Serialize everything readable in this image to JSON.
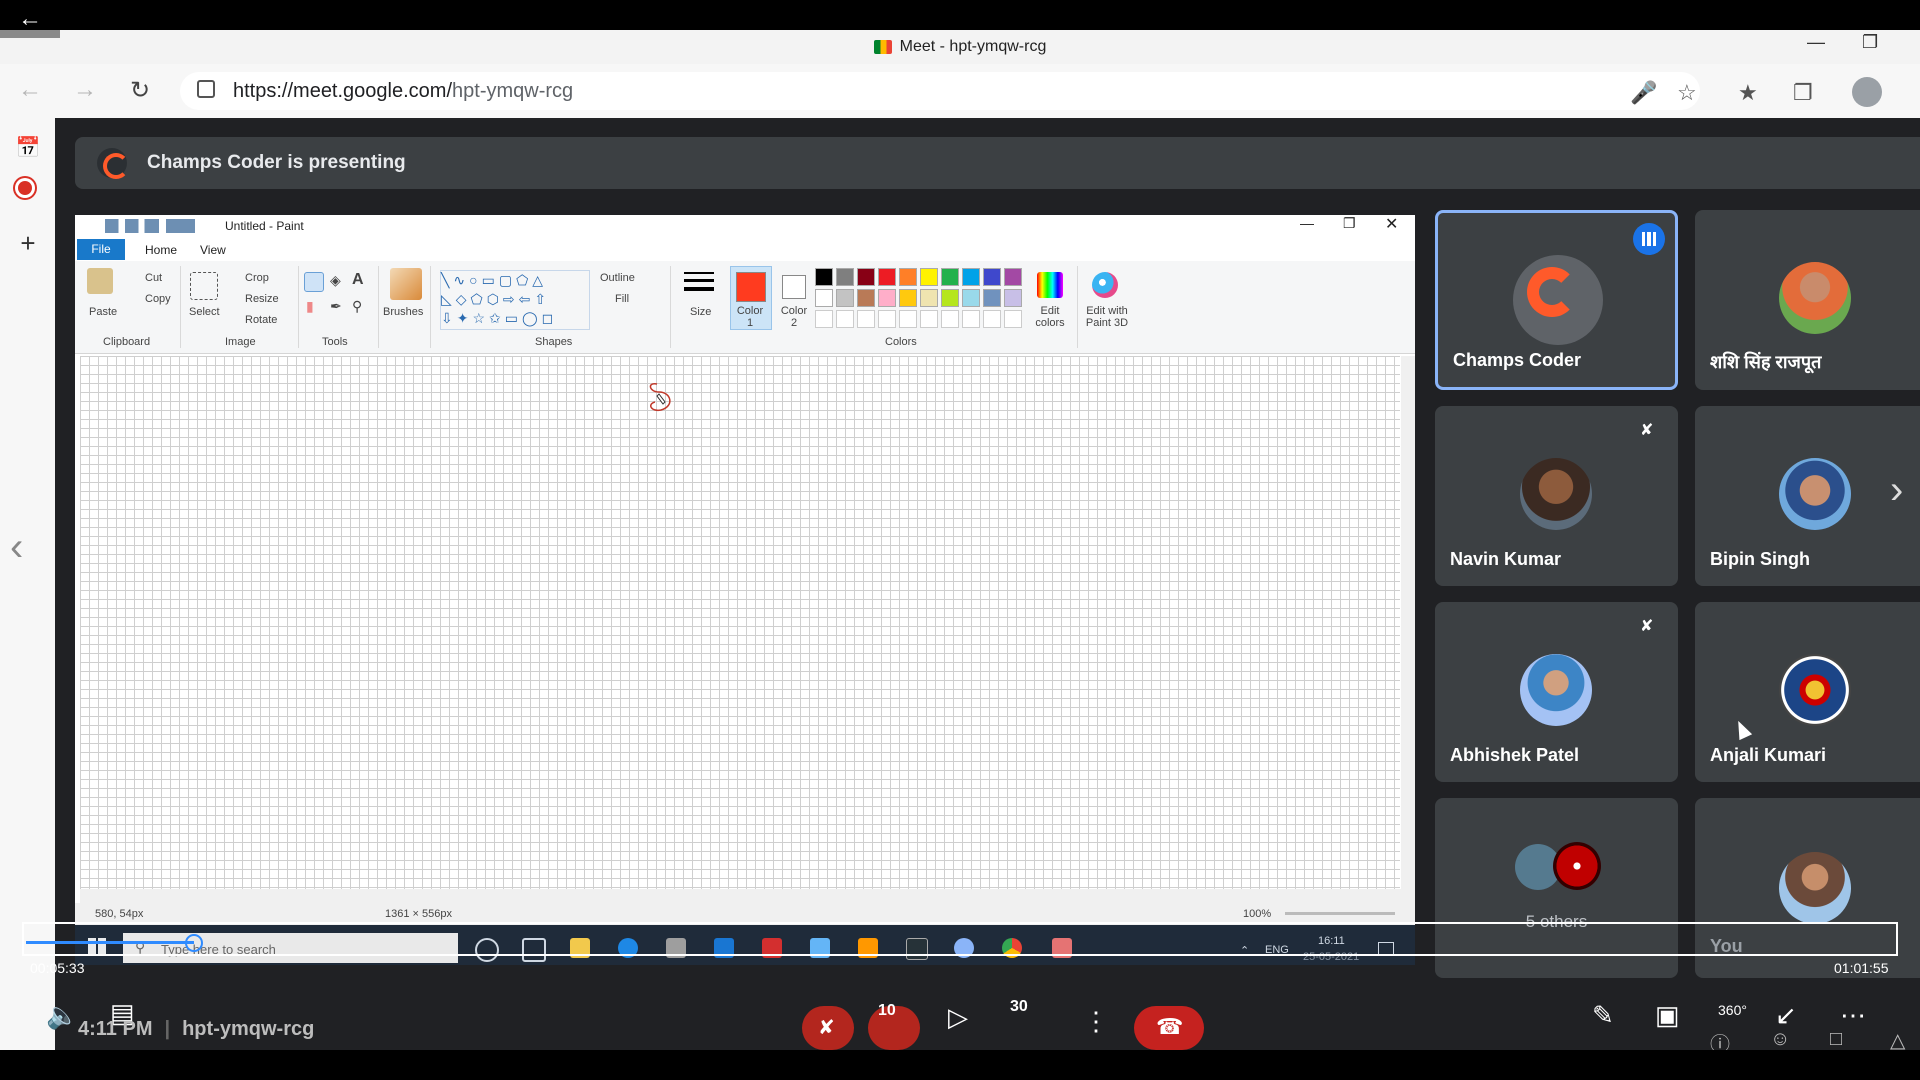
{
  "browser": {
    "tab_title": "Meet - hpt-ymqw-rcg",
    "url_host": "https://meet.google.com/",
    "url_path": "hpt-ymqw-rcg"
  },
  "meet": {
    "presenting_text": "Champs Coder is presenting",
    "meeting_code": "hpt-ymqw-rcg",
    "clock": "4:11 PM"
  },
  "paint": {
    "title": "Untitled - Paint",
    "tabs": [
      "File",
      "Home",
      "View"
    ],
    "clipboard": {
      "paste": "Paste",
      "cut": "Cut",
      "copy": "Copy",
      "label": "Clipboard"
    },
    "image": {
      "select": "Select",
      "crop": "Crop",
      "resize": "Resize",
      "rotate": "Rotate",
      "label": "Image"
    },
    "tools_label": "Tools",
    "brushes": "Brushes",
    "shapes": {
      "outline": "Outline",
      "fill": "Fill",
      "label": "Shapes"
    },
    "size": "Size",
    "color1": "Color 1",
    "color2": "Color 2",
    "colors_label": "Colors",
    "edit_colors": "Edit colors",
    "edit_3d": "Edit with Paint 3D",
    "status_pos": "580, 54px",
    "status_size": "1361 × 556px",
    "zoom": "100%",
    "palette": [
      "#000000",
      "#7f7f7f",
      "#880015",
      "#ed1c24",
      "#ff7f27",
      "#fff200",
      "#22b14c",
      "#00a2e8",
      "#3f48cc",
      "#a349a4",
      "#ffffff",
      "#c3c3c3",
      "#b97a57",
      "#ffaec9",
      "#ffc90e",
      "#efe4b0",
      "#b5e61d",
      "#99d9ea",
      "#7092be",
      "#c8bfe7"
    ],
    "color1_hex": "#ff3b1f"
  },
  "shared_taskbar": {
    "search_placeholder": "Type here to search",
    "lang": "ENG",
    "time": "16:11",
    "date": "25-05-2021"
  },
  "participants": [
    {
      "name": "Champs Coder",
      "speaking": true
    },
    {
      "name": "शशि सिंह राजपूत",
      "muted": true
    },
    {
      "name": "Navin Kumar",
      "muted": true
    },
    {
      "name": "Bipin Singh",
      "muted": true
    },
    {
      "name": "Abhishek Patel",
      "muted": true
    },
    {
      "name": "Anjali Kumari",
      "muted": true
    },
    {
      "name": "5 others"
    },
    {
      "name": "You",
      "muted": true
    }
  ],
  "player": {
    "elapsed": "00:05:33",
    "duration": "01:01:55",
    "progress": 0.09,
    "rewind_label": "10",
    "forward_label": "30",
    "vr_label": "360°"
  }
}
